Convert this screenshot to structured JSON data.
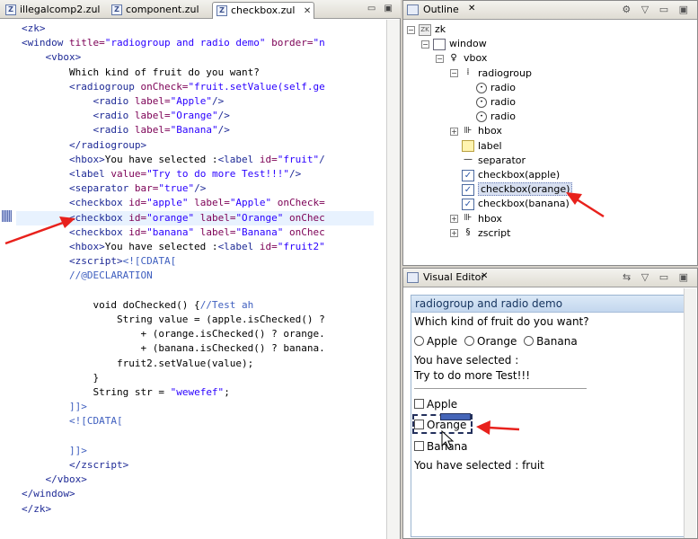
{
  "editor": {
    "tabs": [
      {
        "label": "illegalcomp2.zul"
      },
      {
        "label": "component.zul"
      },
      {
        "label": "checkbox.zul",
        "close": "✕"
      }
    ],
    "code_lines": [
      {
        "segs": [
          [
            "tg",
            "<zk>"
          ]
        ]
      },
      {
        "segs": [
          [
            "tg",
            "<window "
          ],
          [
            "at",
            "title="
          ],
          [
            "st",
            "\"radiogroup and radio demo\""
          ],
          [
            "at",
            " border="
          ],
          [
            "st",
            "\"n"
          ]
        ]
      },
      {
        "segs": [
          [
            "tg",
            "    <vbox>"
          ]
        ]
      },
      {
        "segs": [
          [
            "tx",
            "        Which kind of fruit do you want?"
          ]
        ]
      },
      {
        "segs": [
          [
            "tg",
            "        <radiogroup "
          ],
          [
            "at",
            "onCheck="
          ],
          [
            "st",
            "\"fruit.setValue(self.ge"
          ]
        ]
      },
      {
        "segs": [
          [
            "tg",
            "            <radio "
          ],
          [
            "at",
            "label="
          ],
          [
            "st",
            "\"Apple\""
          ],
          [
            "tg",
            "/>"
          ]
        ]
      },
      {
        "segs": [
          [
            "tg",
            "            <radio "
          ],
          [
            "at",
            "label="
          ],
          [
            "st",
            "\"Orange\""
          ],
          [
            "tg",
            "/>"
          ]
        ]
      },
      {
        "segs": [
          [
            "tg",
            "            <radio "
          ],
          [
            "at",
            "label="
          ],
          [
            "st",
            "\"Banana\""
          ],
          [
            "tg",
            "/>"
          ]
        ]
      },
      {
        "segs": [
          [
            "tg",
            "        </radiogroup>"
          ]
        ]
      },
      {
        "segs": [
          [
            "tg",
            "        <hbox>"
          ],
          [
            "tx",
            "You have selected :"
          ],
          [
            "tg",
            "<label "
          ],
          [
            "at",
            "id="
          ],
          [
            "st",
            "\"fruit\""
          ],
          [
            "tg",
            "/"
          ]
        ]
      },
      {
        "segs": [
          [
            "tg",
            "        <label "
          ],
          [
            "at",
            "value="
          ],
          [
            "st",
            "\"Try to do more Test!!!\""
          ],
          [
            "tg",
            "/>"
          ]
        ]
      },
      {
        "segs": [
          [
            "tg",
            "        <separator "
          ],
          [
            "at",
            "bar="
          ],
          [
            "st",
            "\"true\""
          ],
          [
            "tg",
            "/>"
          ]
        ]
      },
      {
        "segs": [
          [
            "tg",
            "        <checkbox "
          ],
          [
            "at",
            "id="
          ],
          [
            "st",
            "\"apple\""
          ],
          [
            "at",
            " label="
          ],
          [
            "st",
            "\"Apple\""
          ],
          [
            "at",
            " onCheck="
          ]
        ]
      },
      {
        "segs": [
          [
            "tg",
            "        <checkbox "
          ],
          [
            "at",
            "id="
          ],
          [
            "st",
            "\"orange\""
          ],
          [
            "at",
            " label="
          ],
          [
            "st",
            "\"Orange\""
          ],
          [
            "at",
            " onChec"
          ]
        ],
        "highlight": true
      },
      {
        "segs": [
          [
            "tg",
            "        <checkbox "
          ],
          [
            "at",
            "id="
          ],
          [
            "st",
            "\"banana\""
          ],
          [
            "at",
            " label="
          ],
          [
            "st",
            "\"Banana\""
          ],
          [
            "at",
            " onChec"
          ]
        ]
      },
      {
        "segs": [
          [
            "tg",
            "        <hbox>"
          ],
          [
            "tx",
            "You have selected :"
          ],
          [
            "tg",
            "<label "
          ],
          [
            "at",
            "id="
          ],
          [
            "st",
            "\"fruit2\""
          ]
        ]
      },
      {
        "segs": [
          [
            "tg",
            "        <zscript>"
          ],
          [
            "cm",
            "<![CDATA["
          ]
        ]
      },
      {
        "segs": [
          [
            "cm",
            "        //@DECLARATION"
          ]
        ]
      },
      {
        "segs": [
          [
            "tx",
            ""
          ]
        ]
      },
      {
        "segs": [
          [
            "tx",
            "            void doChecked() {"
          ],
          [
            "cm",
            "//Test ah"
          ]
        ]
      },
      {
        "segs": [
          [
            "tx",
            "                String value = (apple.isChecked() ?"
          ]
        ]
      },
      {
        "segs": [
          [
            "tx",
            "                    + (orange.isChecked() ? orange."
          ]
        ]
      },
      {
        "segs": [
          [
            "tx",
            "                    + (banana.isChecked() ? banana."
          ]
        ]
      },
      {
        "segs": [
          [
            "tx",
            "                fruit2.setValue(value);"
          ]
        ]
      },
      {
        "segs": [
          [
            "tx",
            "            }"
          ]
        ]
      },
      {
        "segs": [
          [
            "tx",
            "            String str = "
          ],
          [
            "st",
            "\"wewefef\""
          ],
          [
            "tx",
            ";"
          ]
        ]
      },
      {
        "segs": [
          [
            "cm",
            "        ]]>"
          ]
        ]
      },
      {
        "segs": [
          [
            "cm",
            "        <![CDATA["
          ]
        ]
      },
      {
        "segs": [
          [
            "tx",
            ""
          ]
        ]
      },
      {
        "segs": [
          [
            "cm",
            "        ]]>"
          ]
        ]
      },
      {
        "segs": [
          [
            "tg",
            "        </zscript>"
          ]
        ]
      },
      {
        "segs": [
          [
            "tg",
            "    </vbox>"
          ]
        ]
      },
      {
        "segs": [
          [
            "tg",
            "</window>"
          ]
        ]
      },
      {
        "segs": [
          [
            "tg",
            "</zk>"
          ]
        ]
      }
    ]
  },
  "outline": {
    "title": "Outline",
    "tree": [
      {
        "label": "zk",
        "icon": "zk-icon",
        "toggle": "−"
      },
      {
        "label": "window",
        "icon": "window-icon",
        "toggle": "−"
      },
      {
        "label": "vbox",
        "icon": "vbox-icon",
        "toggle": "−"
      },
      {
        "label": "radiogroup",
        "icon": "radiogroup-icon",
        "toggle": "−"
      },
      {
        "label": "radio",
        "icon": "radio-icon"
      },
      {
        "label": "radio",
        "icon": "radio-icon"
      },
      {
        "label": "radio",
        "icon": "radio-icon"
      },
      {
        "label": "hbox",
        "icon": "hbox-icon",
        "toggle": "+"
      },
      {
        "label": "label",
        "icon": "label-icon"
      },
      {
        "label": "separator",
        "icon": "separator-icon"
      },
      {
        "label": "checkbox(apple)",
        "icon": "checkbox-icon"
      },
      {
        "label": "checkbox(orange)",
        "icon": "checkbox-icon",
        "selected": true
      },
      {
        "label": "checkbox(banana)",
        "icon": "checkbox-icon"
      },
      {
        "label": "hbox",
        "icon": "hbox-icon",
        "toggle": "+"
      },
      {
        "label": "zscript",
        "icon": "zscript-icon",
        "toggle": "+"
      }
    ]
  },
  "visual_editor": {
    "title": "Visual Editor",
    "window_title": "radiogroup and radio demo",
    "question": "Which kind of fruit do you want?",
    "radios": [
      "Apple",
      "Orange",
      "Banana"
    ],
    "selected_text": "You have selected :",
    "try_text": "Try to do more Test!!!",
    "checkboxes": [
      "Apple",
      "Orange",
      "Banana"
    ],
    "selected_fruit_text": "You have selected : fruit"
  },
  "colors": {
    "arrow": "#e8211c",
    "selection": "#4565b8"
  }
}
